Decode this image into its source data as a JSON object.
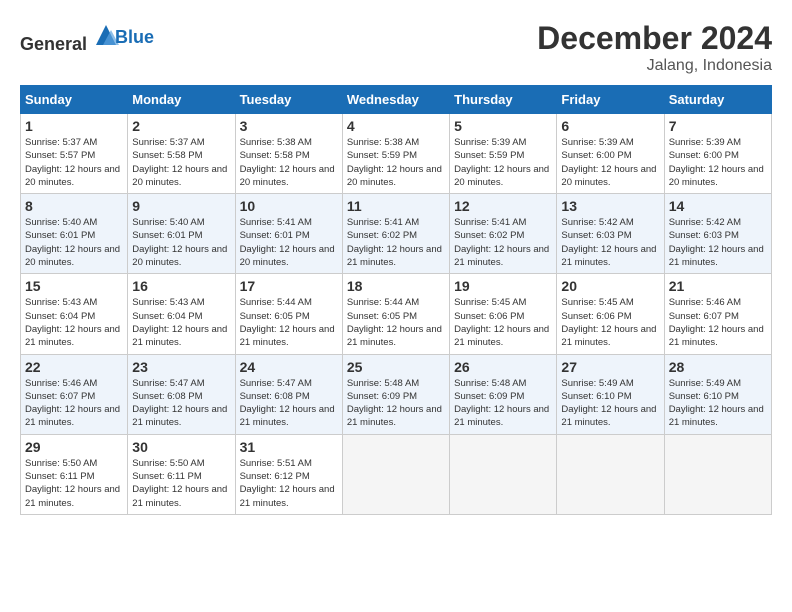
{
  "header": {
    "logo_general": "General",
    "logo_blue": "Blue",
    "month": "December 2024",
    "location": "Jalang, Indonesia"
  },
  "days_of_week": [
    "Sunday",
    "Monday",
    "Tuesday",
    "Wednesday",
    "Thursday",
    "Friday",
    "Saturday"
  ],
  "weeks": [
    [
      {
        "day": "1",
        "sunrise": "5:37 AM",
        "sunset": "5:57 PM",
        "daylight": "12 hours and 20 minutes."
      },
      {
        "day": "2",
        "sunrise": "5:37 AM",
        "sunset": "5:58 PM",
        "daylight": "12 hours and 20 minutes."
      },
      {
        "day": "3",
        "sunrise": "5:38 AM",
        "sunset": "5:58 PM",
        "daylight": "12 hours and 20 minutes."
      },
      {
        "day": "4",
        "sunrise": "5:38 AM",
        "sunset": "5:59 PM",
        "daylight": "12 hours and 20 minutes."
      },
      {
        "day": "5",
        "sunrise": "5:39 AM",
        "sunset": "5:59 PM",
        "daylight": "12 hours and 20 minutes."
      },
      {
        "day": "6",
        "sunrise": "5:39 AM",
        "sunset": "6:00 PM",
        "daylight": "12 hours and 20 minutes."
      },
      {
        "day": "7",
        "sunrise": "5:39 AM",
        "sunset": "6:00 PM",
        "daylight": "12 hours and 20 minutes."
      }
    ],
    [
      {
        "day": "8",
        "sunrise": "5:40 AM",
        "sunset": "6:01 PM",
        "daylight": "12 hours and 20 minutes."
      },
      {
        "day": "9",
        "sunrise": "5:40 AM",
        "sunset": "6:01 PM",
        "daylight": "12 hours and 20 minutes."
      },
      {
        "day": "10",
        "sunrise": "5:41 AM",
        "sunset": "6:01 PM",
        "daylight": "12 hours and 20 minutes."
      },
      {
        "day": "11",
        "sunrise": "5:41 AM",
        "sunset": "6:02 PM",
        "daylight": "12 hours and 21 minutes."
      },
      {
        "day": "12",
        "sunrise": "5:41 AM",
        "sunset": "6:02 PM",
        "daylight": "12 hours and 21 minutes."
      },
      {
        "day": "13",
        "sunrise": "5:42 AM",
        "sunset": "6:03 PM",
        "daylight": "12 hours and 21 minutes."
      },
      {
        "day": "14",
        "sunrise": "5:42 AM",
        "sunset": "6:03 PM",
        "daylight": "12 hours and 21 minutes."
      }
    ],
    [
      {
        "day": "15",
        "sunrise": "5:43 AM",
        "sunset": "6:04 PM",
        "daylight": "12 hours and 21 minutes."
      },
      {
        "day": "16",
        "sunrise": "5:43 AM",
        "sunset": "6:04 PM",
        "daylight": "12 hours and 21 minutes."
      },
      {
        "day": "17",
        "sunrise": "5:44 AM",
        "sunset": "6:05 PM",
        "daylight": "12 hours and 21 minutes."
      },
      {
        "day": "18",
        "sunrise": "5:44 AM",
        "sunset": "6:05 PM",
        "daylight": "12 hours and 21 minutes."
      },
      {
        "day": "19",
        "sunrise": "5:45 AM",
        "sunset": "6:06 PM",
        "daylight": "12 hours and 21 minutes."
      },
      {
        "day": "20",
        "sunrise": "5:45 AM",
        "sunset": "6:06 PM",
        "daylight": "12 hours and 21 minutes."
      },
      {
        "day": "21",
        "sunrise": "5:46 AM",
        "sunset": "6:07 PM",
        "daylight": "12 hours and 21 minutes."
      }
    ],
    [
      {
        "day": "22",
        "sunrise": "5:46 AM",
        "sunset": "6:07 PM",
        "daylight": "12 hours and 21 minutes."
      },
      {
        "day": "23",
        "sunrise": "5:47 AM",
        "sunset": "6:08 PM",
        "daylight": "12 hours and 21 minutes."
      },
      {
        "day": "24",
        "sunrise": "5:47 AM",
        "sunset": "6:08 PM",
        "daylight": "12 hours and 21 minutes."
      },
      {
        "day": "25",
        "sunrise": "5:48 AM",
        "sunset": "6:09 PM",
        "daylight": "12 hours and 21 minutes."
      },
      {
        "day": "26",
        "sunrise": "5:48 AM",
        "sunset": "6:09 PM",
        "daylight": "12 hours and 21 minutes."
      },
      {
        "day": "27",
        "sunrise": "5:49 AM",
        "sunset": "6:10 PM",
        "daylight": "12 hours and 21 minutes."
      },
      {
        "day": "28",
        "sunrise": "5:49 AM",
        "sunset": "6:10 PM",
        "daylight": "12 hours and 21 minutes."
      }
    ],
    [
      {
        "day": "29",
        "sunrise": "5:50 AM",
        "sunset": "6:11 PM",
        "daylight": "12 hours and 21 minutes."
      },
      {
        "day": "30",
        "sunrise": "5:50 AM",
        "sunset": "6:11 PM",
        "daylight": "12 hours and 21 minutes."
      },
      {
        "day": "31",
        "sunrise": "5:51 AM",
        "sunset": "6:12 PM",
        "daylight": "12 hours and 21 minutes."
      },
      null,
      null,
      null,
      null
    ]
  ]
}
